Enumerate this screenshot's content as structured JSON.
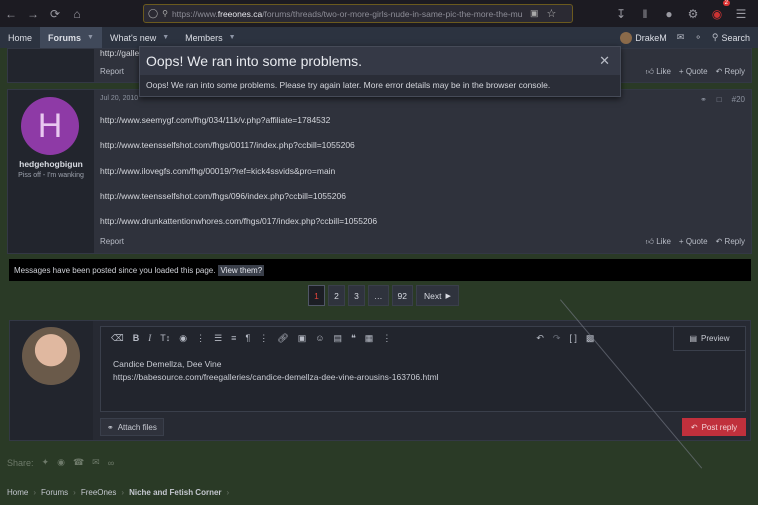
{
  "browser": {
    "url_prefix": "https://www.",
    "url_domain": "freeones.ca",
    "url_rest": "/forums/threads/two-or-more-girls-nude-in-same-pic-the-more-the-mu",
    "profile_badge": "2"
  },
  "sitenav": {
    "home": "Home",
    "forums": "Forums",
    "whats_new": "What's new",
    "members": "Members",
    "username": "DrakeM",
    "search": "Search"
  },
  "post_prev": {
    "link_fragment": "http://galle",
    "report": "Report",
    "like": "Like",
    "quote": "Quote",
    "reply": "Reply"
  },
  "post20": {
    "avatar_letter": "H",
    "username": "hedgehogbigun",
    "user_title": "Piss off - I'm wanking",
    "date": "Jul 20, 2010",
    "number": "#20",
    "links": [
      "http://www.seemygf.com/fhg/034/11k/v.php?affiliate=1784532",
      "http://www.teensselfshot.com/fhgs/00117/index.php?ccbill=1055206",
      "http://www.ilovegfs.com/fhg/00019/?ref=kick4ssvids&pro=main",
      "http://www.teensselfshot.com/fhgs/096/index.php?ccbill=1055206",
      "http://www.drunkattentionwhores.com/fhgs/017/index.php?ccbill=1055206"
    ],
    "report": "Report",
    "like": "Like",
    "quote": "Quote",
    "reply": "Reply"
  },
  "notice": {
    "text": "Messages have been posted since you loaded this page.",
    "link": "View them?"
  },
  "pagination": {
    "pages": [
      "1",
      "2",
      "3",
      "…",
      "92"
    ],
    "next": "Next"
  },
  "editor": {
    "line1": "Candice Demellza, Dee Vine",
    "line2": "https://babesource.com/freegalleries/candice-demellza-dee-vine-arousins-163706.html",
    "preview": "Preview",
    "attach": "Attach files",
    "post_reply": "Post reply"
  },
  "share": {
    "label": "Share:"
  },
  "breadcrumb": [
    "Home",
    "Forums",
    "FreeOnes",
    "Niche and Fetish Corner"
  ],
  "toast": {
    "title": "Oops! We ran into some problems.",
    "message": "Oops! We ran into some problems. Please try again later. More error details may be in the browser console."
  }
}
